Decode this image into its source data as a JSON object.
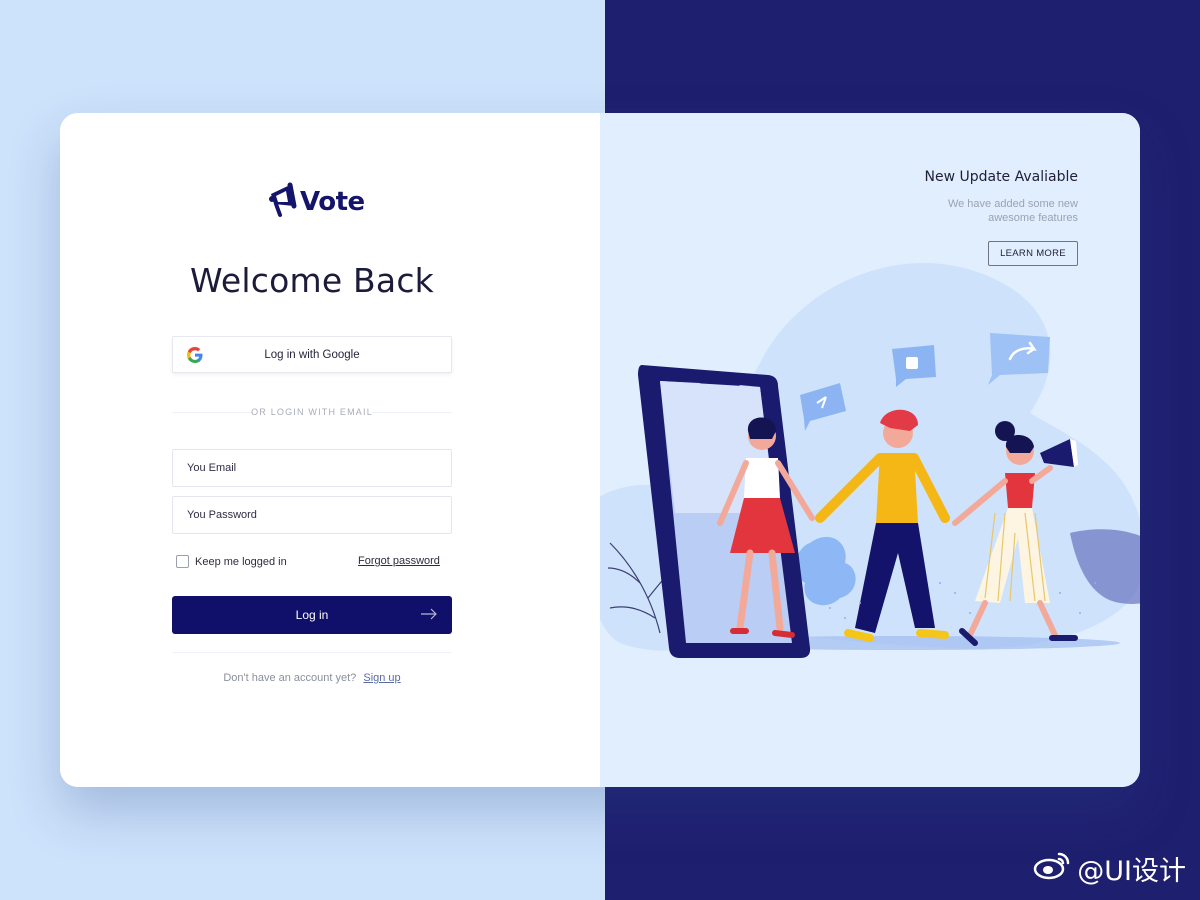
{
  "brand": {
    "name": "Vote"
  },
  "login": {
    "title": "Welcome Back",
    "google_label": "Log in with Google",
    "divider": "OR LOGIN WITH EMAIL",
    "email_placeholder": "You Email",
    "password_placeholder": "You Password",
    "keep_logged_in": "Keep me logged in",
    "keep_checked": false,
    "forgot": "Forgot password",
    "login_label": "Log in",
    "no_account": "Don't have an account yet?",
    "signup": "Sign up"
  },
  "update": {
    "title": "New Update Avaliable",
    "subtitle_line1": "We have added some new",
    "subtitle_line2": "awesome features",
    "button": "LEARN MORE"
  },
  "watermark": {
    "text": "@UI设计"
  },
  "colors": {
    "primary": "#10106a",
    "bg_left": "#cde2fb",
    "bg_right": "#1f1f6f",
    "panel_right": "#e1eefd"
  },
  "icons": [
    "megaphone-icon",
    "google-icon",
    "arrow-right-icon",
    "checkbox-icon",
    "weibo-icon"
  ]
}
